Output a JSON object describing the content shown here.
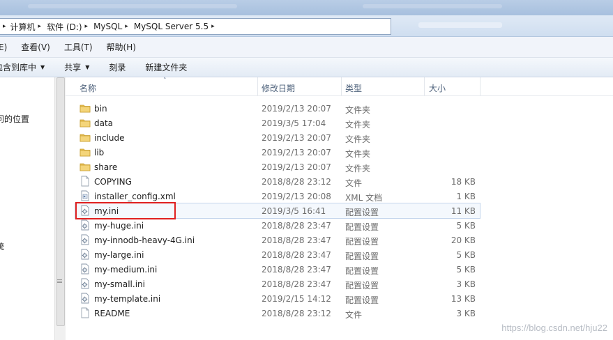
{
  "address": {
    "crumbs": [
      "计算机",
      "软件 (D:)",
      "MySQL",
      "MySQL Server 5.5"
    ]
  },
  "menubar": {
    "items": [
      "E)",
      "查看(V)",
      "工具(T)",
      "帮助(H)"
    ]
  },
  "toolbar": {
    "include_in_library": "包含到库中",
    "share": "共享",
    "burn": "刻录",
    "new_folder": "新建文件夹"
  },
  "navpane": {
    "item_recent": "问的位置",
    "item_edge": "统"
  },
  "columns": {
    "name": "名称",
    "modified": "修改日期",
    "type": "类型",
    "size": "大小"
  },
  "files": [
    {
      "icon": "folder-icon",
      "name": "bin",
      "modified": "2019/2/13 20:07",
      "type": "文件夹",
      "size": ""
    },
    {
      "icon": "folder-icon",
      "name": "data",
      "modified": "2019/3/5 17:04",
      "type": "文件夹",
      "size": ""
    },
    {
      "icon": "folder-icon",
      "name": "include",
      "modified": "2019/2/13 20:07",
      "type": "文件夹",
      "size": ""
    },
    {
      "icon": "folder-icon",
      "name": "lib",
      "modified": "2019/2/13 20:07",
      "type": "文件夹",
      "size": ""
    },
    {
      "icon": "folder-icon",
      "name": "share",
      "modified": "2019/2/13 20:07",
      "type": "文件夹",
      "size": ""
    },
    {
      "icon": "file-icon",
      "name": "COPYING",
      "modified": "2018/8/28 23:12",
      "type": "文件",
      "size": "18 KB"
    },
    {
      "icon": "xml-file-icon",
      "name": "installer_config.xml",
      "modified": "2019/2/13 20:08",
      "type": "XML 文档",
      "size": "1 KB"
    },
    {
      "icon": "config-file-icon",
      "name": "my.ini",
      "modified": "2019/3/5 16:41",
      "type": "配置设置",
      "size": "11 KB",
      "selected": true
    },
    {
      "icon": "config-file-icon",
      "name": "my-huge.ini",
      "modified": "2018/8/28 23:47",
      "type": "配置设置",
      "size": "5 KB"
    },
    {
      "icon": "config-file-icon",
      "name": "my-innodb-heavy-4G.ini",
      "modified": "2018/8/28 23:47",
      "type": "配置设置",
      "size": "20 KB"
    },
    {
      "icon": "config-file-icon",
      "name": "my-large.ini",
      "modified": "2018/8/28 23:47",
      "type": "配置设置",
      "size": "5 KB"
    },
    {
      "icon": "config-file-icon",
      "name": "my-medium.ini",
      "modified": "2018/8/28 23:47",
      "type": "配置设置",
      "size": "5 KB"
    },
    {
      "icon": "config-file-icon",
      "name": "my-small.ini",
      "modified": "2018/8/28 23:47",
      "type": "配置设置",
      "size": "3 KB"
    },
    {
      "icon": "config-file-icon",
      "name": "my-template.ini",
      "modified": "2019/2/15 14:12",
      "type": "配置设置",
      "size": "13 KB"
    },
    {
      "icon": "file-icon",
      "name": "README",
      "modified": "2018/8/28 23:12",
      "type": "文件",
      "size": "3 KB"
    }
  ],
  "colors": {
    "highlight_border": "#e02020",
    "folder": "#e8c25a"
  },
  "watermark": "https://blog.csdn.net/hju22"
}
